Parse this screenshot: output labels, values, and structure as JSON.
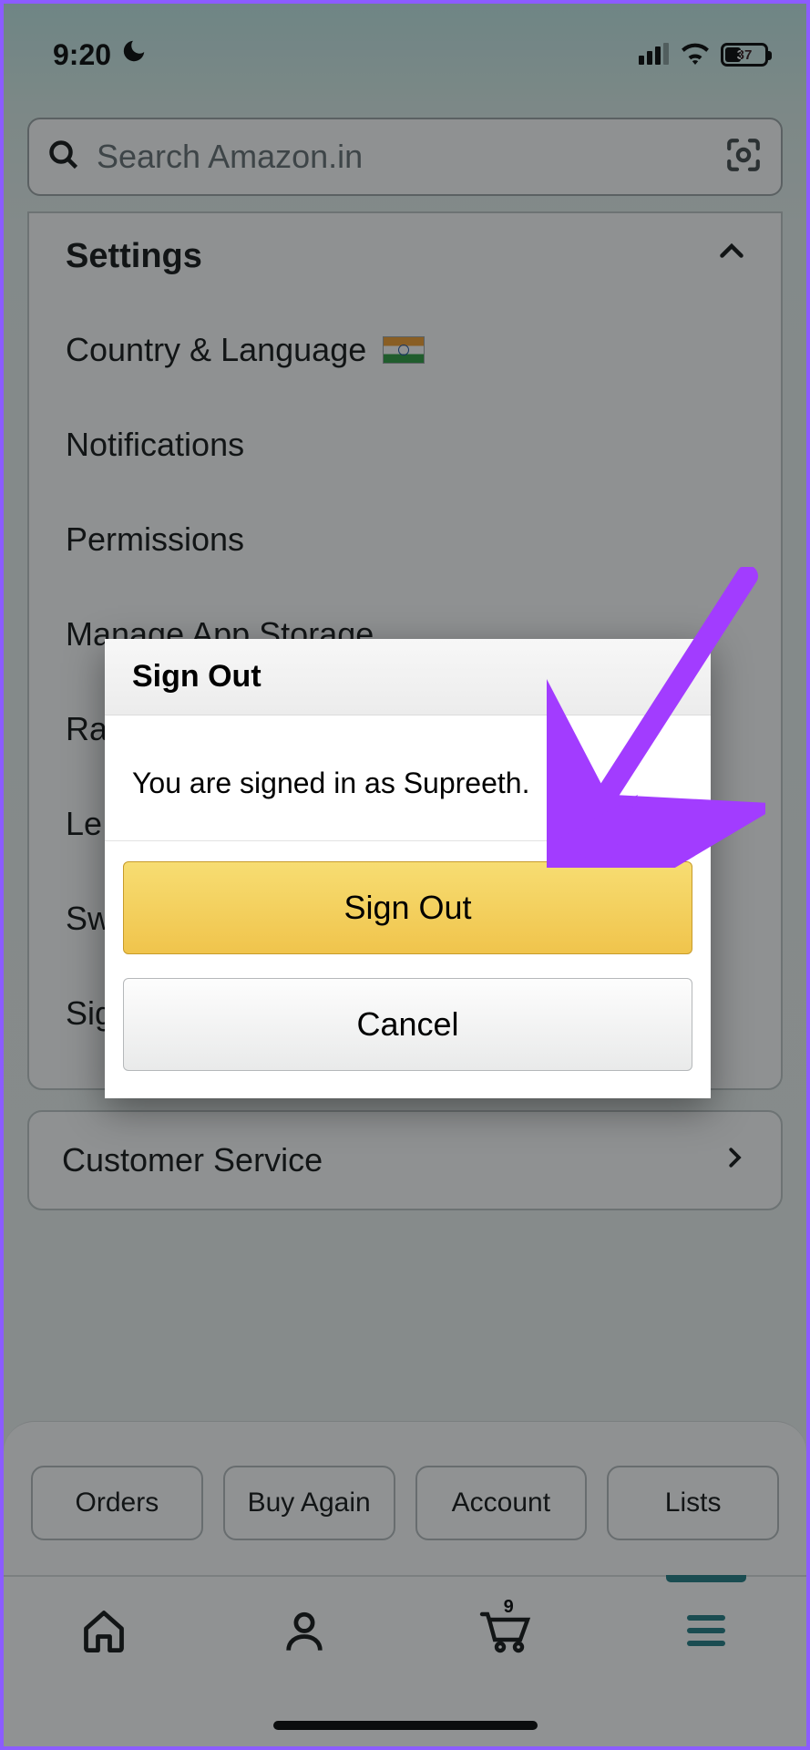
{
  "status": {
    "time": "9:20",
    "battery_percent": "37"
  },
  "search": {
    "placeholder": "Search Amazon.in"
  },
  "settings": {
    "header": "Settings",
    "items": {
      "country_language": "Country & Language",
      "notifications": "Notifications",
      "permissions": "Permissions",
      "manage_storage": "Manage App Storage",
      "rate": "Ra",
      "legal": "Le",
      "switch": "Sw",
      "signout": "Sig"
    }
  },
  "customer_service": {
    "label": "Customer Service"
  },
  "chips": {
    "orders": "Orders",
    "buy_again": "Buy Again",
    "account": "Account",
    "lists": "Lists"
  },
  "tabbar": {
    "cart_count": "9"
  },
  "dialog": {
    "title": "Sign Out",
    "message": "You are signed in as Supreeth.",
    "confirm": "Sign Out",
    "cancel": "Cancel"
  }
}
